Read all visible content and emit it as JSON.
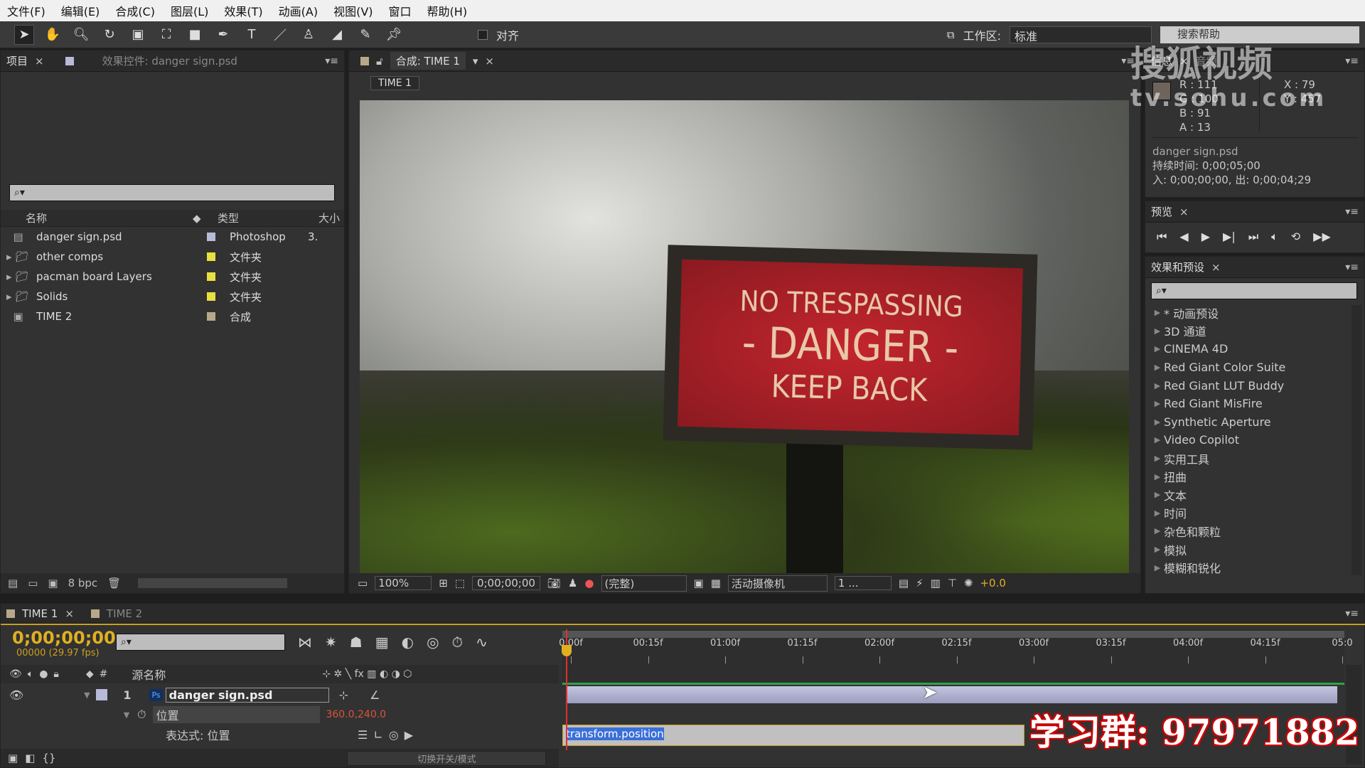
{
  "menu": [
    "文件(F)",
    "编辑(E)",
    "合成(C)",
    "图层(L)",
    "效果(T)",
    "动画(A)",
    "视图(V)",
    "窗口",
    "帮助(H)"
  ],
  "toolbar": {
    "snap_label": "对齐",
    "workspace_label": "工作区:",
    "workspace_value": "标准",
    "search_help": "搜索帮助"
  },
  "project": {
    "tab": "项目",
    "effects_tab": "效果控件: danger sign.psd",
    "columns": {
      "name": "名称",
      "type": "类型",
      "size": "大小"
    },
    "items": [
      {
        "name": "danger sign.psd",
        "type": "Photoshop",
        "size": "3.",
        "color": "#b9b9d8",
        "kind": "psd"
      },
      {
        "name": "other comps",
        "type": "文件夹",
        "size": "",
        "color": "#e8e040",
        "kind": "folder"
      },
      {
        "name": "pacman board Layers",
        "type": "文件夹",
        "size": "",
        "color": "#e8e040",
        "kind": "folder"
      },
      {
        "name": "Solids",
        "type": "文件夹",
        "size": "",
        "color": "#e8e040",
        "kind": "folder"
      },
      {
        "name": "TIME 2",
        "type": "合成",
        "size": "",
        "color": "#b8a88a",
        "kind": "comp"
      }
    ],
    "bpc": "8 bpc"
  },
  "viewer": {
    "tab": "合成: TIME 1",
    "comp_label": "TIME 1",
    "zoom": "100%",
    "timecode": "0;00;00;00",
    "quality": "(完整)",
    "camera": "活动摄像机",
    "views": "1 ...",
    "exposure": "+0.0",
    "sign": {
      "line1": "NO TRESPASSING",
      "line2": "- DANGER -",
      "line3": "KEEP BACK"
    }
  },
  "info": {
    "tab": "信息",
    "audio_tab": "音频",
    "r": "R : 111",
    "g": "G : 100",
    "b": "B : 91",
    "a": "A : 13",
    "x": "X : 79",
    "y": "Y : 457",
    "file": "danger sign.psd",
    "duration": "持续时间: 0;00;05;00",
    "inout": "入: 0;00;00;00, 出: 0;00;04;29"
  },
  "preview": {
    "tab": "预览"
  },
  "effects": {
    "tab": "效果和预设",
    "items": [
      "* 动画预设",
      "3D 通道",
      "CINEMA 4D",
      "Red Giant Color Suite",
      "Red Giant LUT Buddy",
      "Red Giant MisFire",
      "Synthetic Aperture",
      "Video Copilot",
      "实用工具",
      "扭曲",
      "文本",
      "时间",
      "杂色和颗粒",
      "模拟",
      "模糊和锐化"
    ]
  },
  "timeline": {
    "tabs": [
      "TIME 1",
      "TIME 2"
    ],
    "timecode": "0;00;00;00",
    "fps": "00000 (29.97 fps)",
    "source_name": "源名称",
    "ruler": [
      "0:00f",
      "00:15f",
      "01:00f",
      "01:15f",
      "02:00f",
      "02:15f",
      "03:00f",
      "03:15f",
      "04:00f",
      "04:15f",
      "05:0"
    ],
    "layer": {
      "index": "1",
      "name": "danger sign.psd"
    },
    "property": "位置",
    "property_value": "360.0,240.0",
    "expression_label": "表达式: 位置",
    "expression": "transform.position",
    "toggle_label": "切换开关/模式"
  },
  "watermarks": {
    "sohu": "搜狐视频",
    "sohu_url": "tv.sohu.com",
    "group": "学习群: 97971882"
  },
  "colors": {
    "timecode": "#e0b020",
    "accent_value": "#d9553a",
    "layer_bar": "#aeb0d0"
  }
}
